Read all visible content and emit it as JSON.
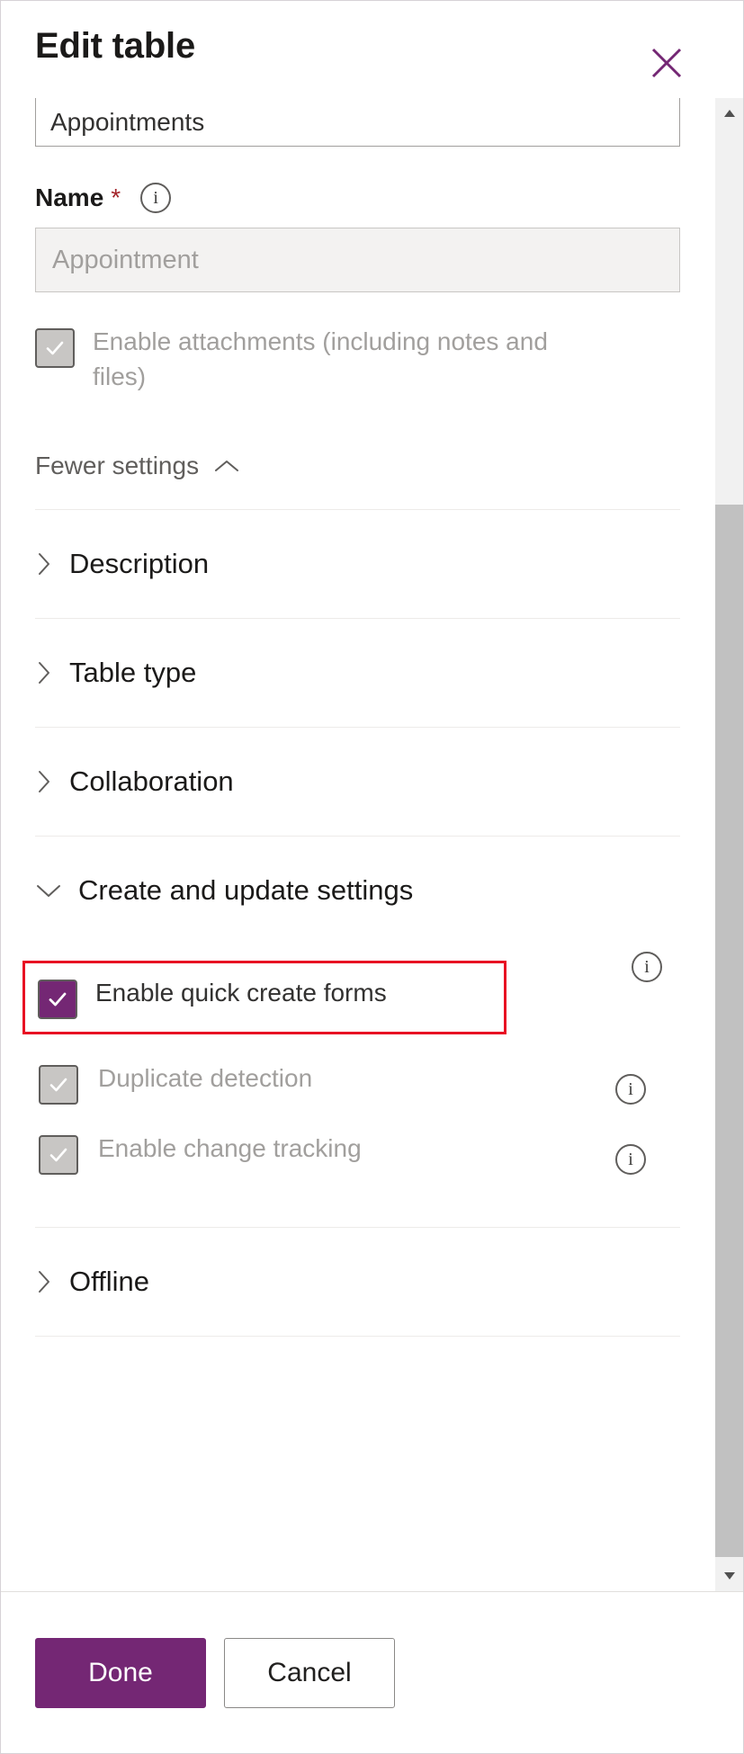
{
  "panel": {
    "title": "Edit table",
    "close_icon": "close-icon",
    "accent_purple": "#742774",
    "highlight_color": "#e81123"
  },
  "form": {
    "display_name_field": {
      "value": "Appointments"
    },
    "name_field": {
      "label": "Name",
      "required_marker": "*",
      "info_icon": "info-icon",
      "placeholder": "Appointment",
      "value": "",
      "disabled": true
    },
    "attachments_checkbox": {
      "label": "Enable attachments (including notes and files)",
      "checked": true,
      "disabled": true
    },
    "settings_toggle": {
      "label": "Fewer settings",
      "icon": "chevron-up-icon",
      "expanded": true
    }
  },
  "sections": [
    {
      "label": "Description",
      "icon": "chevron-right-icon",
      "expanded": false
    },
    {
      "label": "Table type",
      "icon": "chevron-right-icon",
      "expanded": false
    },
    {
      "label": "Collaboration",
      "icon": "chevron-right-icon",
      "expanded": false
    }
  ],
  "create_update_section": {
    "label": "Create and update settings",
    "icon": "chevron-down-icon",
    "expanded": true,
    "options": [
      {
        "label": "Enable quick create forms",
        "checked": true,
        "disabled": false,
        "highlighted": true,
        "info_icon": "info-icon"
      },
      {
        "label": "Duplicate detection",
        "checked": true,
        "disabled": true,
        "highlighted": false,
        "info_icon": "info-icon"
      },
      {
        "label": "Enable change tracking",
        "checked": true,
        "disabled": true,
        "highlighted": false,
        "info_icon": "info-icon"
      }
    ]
  },
  "offline_section": {
    "label": "Offline",
    "icon": "chevron-right-icon",
    "expanded": false
  },
  "scrollbar": {
    "up_arrow_icon": "scroll-up-arrow-icon",
    "down_arrow_icon": "scroll-down-arrow-icon"
  },
  "footer": {
    "done_label": "Done",
    "cancel_label": "Cancel"
  }
}
